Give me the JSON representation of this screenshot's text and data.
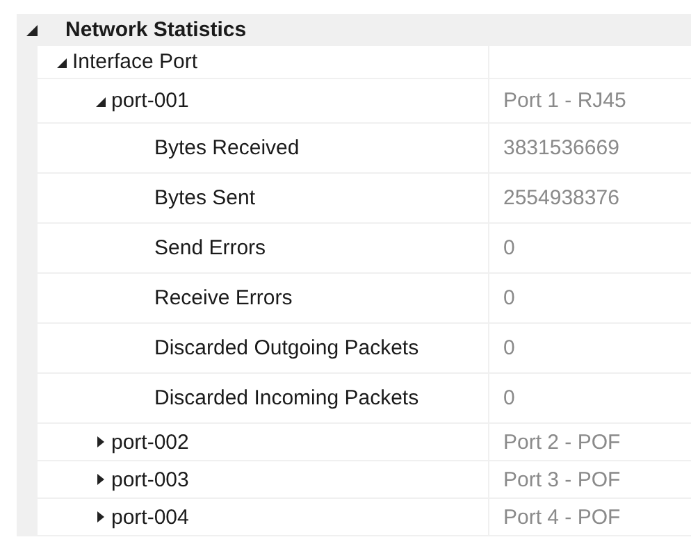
{
  "category": {
    "label": "Network Statistics",
    "expanded": true,
    "children": [
      {
        "label": "Interface Port",
        "expanded": true,
        "children": [
          {
            "label": "port-001",
            "value": "Port 1 - RJ45",
            "expanded": true,
            "children": [
              {
                "label": "Bytes Received",
                "value": "3831536669"
              },
              {
                "label": "Bytes Sent",
                "value": "2554938376"
              },
              {
                "label": "Send Errors",
                "value": "0"
              },
              {
                "label": "Receive Errors",
                "value": "0"
              },
              {
                "label": "Discarded Outgoing Packets",
                "value": "0"
              },
              {
                "label": "Discarded Incoming Packets",
                "value": "0"
              }
            ]
          },
          {
            "label": "port-002",
            "value": "Port 2 - POF",
            "expanded": false
          },
          {
            "label": "port-003",
            "value": "Port 3 - POF",
            "expanded": false
          },
          {
            "label": "port-004",
            "value": "Port 4 - POF",
            "expanded": false
          }
        ]
      }
    ]
  }
}
